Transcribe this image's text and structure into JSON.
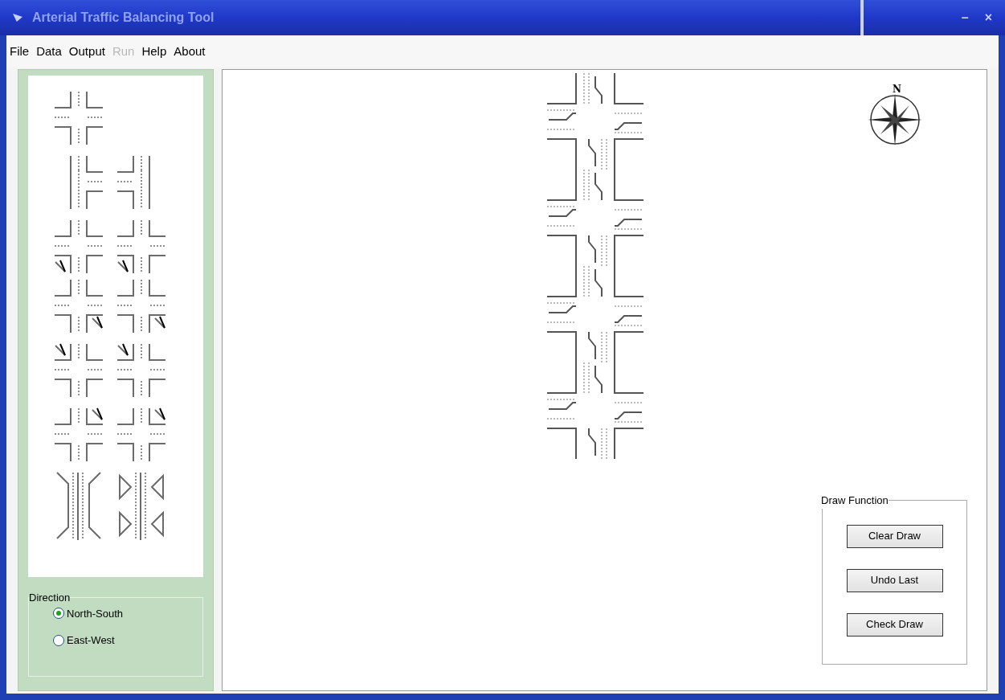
{
  "window": {
    "title": "Arterial Traffic Balancing Tool",
    "controls": [
      "–",
      "×"
    ]
  },
  "menu": [
    {
      "label": "File",
      "disabled": false
    },
    {
      "label": "Data",
      "disabled": false
    },
    {
      "label": "Output",
      "disabled": false
    },
    {
      "label": "Run",
      "disabled": true
    },
    {
      "label": "Help",
      "disabled": false
    },
    {
      "label": "About",
      "disabled": false
    }
  ],
  "direction": {
    "title": "Direction",
    "options": [
      {
        "label": "North-South",
        "selected": true
      },
      {
        "label": "East-West",
        "selected": false
      }
    ]
  },
  "canvas": {
    "compass_label": "N"
  },
  "draw_function": {
    "title": "Draw Function",
    "buttons": [
      "Clear Draw",
      "Undo Last",
      "Check Draw"
    ]
  }
}
